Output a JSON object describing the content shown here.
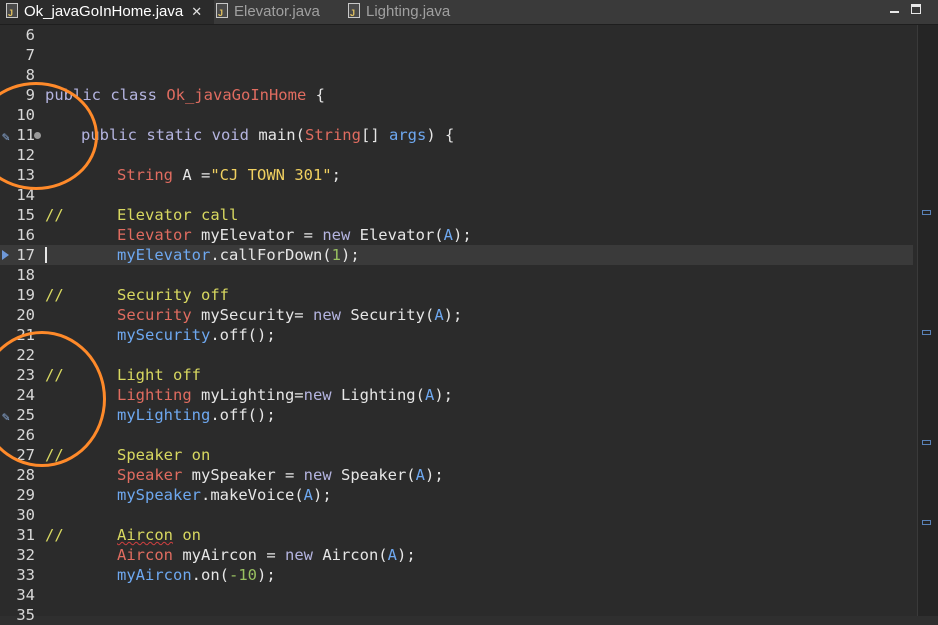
{
  "tabs": [
    {
      "label": "Ok_javaGoInHome.java",
      "active": true,
      "closable": true
    },
    {
      "label": "Elevator.java",
      "active": false
    },
    {
      "label": "Lighting.java",
      "active": false
    }
  ],
  "window_controls": [
    "minimize-icon",
    "maximize-icon"
  ],
  "editor": {
    "current_line": 17,
    "lines": [
      {
        "n": "6"
      },
      {
        "n": "7"
      },
      {
        "n": "8"
      },
      {
        "n": "9"
      },
      {
        "n": "10"
      },
      {
        "n": "11"
      },
      {
        "n": "12"
      },
      {
        "n": "13"
      },
      {
        "n": "14"
      },
      {
        "n": "15"
      },
      {
        "n": "16"
      },
      {
        "n": "17"
      },
      {
        "n": "18"
      },
      {
        "n": "19"
      },
      {
        "n": "20"
      },
      {
        "n": "21"
      },
      {
        "n": "22"
      },
      {
        "n": "23"
      },
      {
        "n": "24"
      },
      {
        "n": "25"
      },
      {
        "n": "26"
      },
      {
        "n": "27"
      },
      {
        "n": "28"
      },
      {
        "n": "29"
      },
      {
        "n": "30"
      },
      {
        "n": "31"
      },
      {
        "n": "32"
      },
      {
        "n": "33"
      },
      {
        "n": "34"
      },
      {
        "n": "35"
      }
    ],
    "code": {
      "l9": {
        "a": "public class ",
        "b": "Ok_javaGoInHome",
        "c": " {"
      },
      "l11": {
        "a": "public static void ",
        "b": "main(",
        "c": "String",
        "d": "[] ",
        "e": "args",
        "f": ") {"
      },
      "l13": {
        "a": "String",
        "b": " A =",
        "c": "\"CJ TOWN 301\"",
        "d": ";"
      },
      "l15": {
        "a": "//",
        "b": "Elevator call"
      },
      "l16": {
        "a": "Elevator",
        "b": " myElevator = ",
        "c": "new",
        "d": " Elevator(",
        "e": "A",
        "f": ");"
      },
      "l17": {
        "a": "myElevator",
        "b": ".callForDown(",
        "c": "1",
        "d": ");"
      },
      "l19": {
        "a": "//",
        "b": "Security off"
      },
      "l20": {
        "a": "Security",
        "b": " mySecurity= ",
        "c": "new",
        "d": " Security(",
        "e": "A",
        "f": ");"
      },
      "l21": {
        "a": "mySecurity",
        "b": ".off();"
      },
      "l23": {
        "a": "//",
        "b": "Light off"
      },
      "l24": {
        "a": "Lighting",
        "b": " myLighting=",
        "c": "new",
        "d": " Lighting(",
        "e": "A",
        "f": ");"
      },
      "l25": {
        "a": "myLighting",
        "b": ".off();"
      },
      "l27": {
        "a": "//",
        "b": "Speaker on"
      },
      "l28": {
        "a": "Speaker",
        "b": " mySpeaker = ",
        "c": "new",
        "d": " Speaker(",
        "e": "A",
        "f": ");"
      },
      "l29": {
        "a": "mySpeaker",
        "b": ".makeVoice(",
        "c": "A",
        "d": ");"
      },
      "l31": {
        "a": "//",
        "b": "Aircon",
        "c": " on"
      },
      "l32": {
        "a": "Aircon",
        "b": " myAircon = ",
        "c": "new",
        "d": " Aircon(",
        "e": "A",
        "f": ");"
      },
      "l33": {
        "a": "myAircon",
        "b": ".on(",
        "c": "-10",
        "d": ");"
      }
    }
  },
  "colors": {
    "annotation_circle": "#ff8a2a",
    "class_name": "#e06c60",
    "variable": "#6ea8f0",
    "string": "#f0d060",
    "comment": "#d8d860"
  }
}
